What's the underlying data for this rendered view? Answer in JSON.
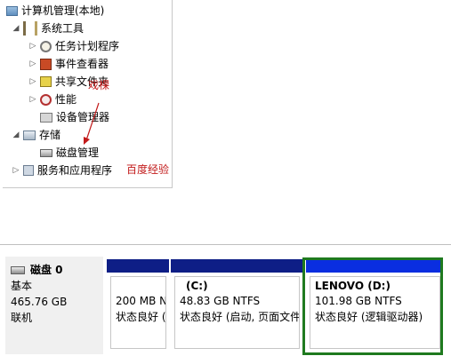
{
  "tree": {
    "root": "计算机管理(本地)",
    "system_tools": "系统工具",
    "task_scheduler": "任务计划程序",
    "event_viewer": "事件查看器",
    "shared_folders": "共享文件夹",
    "performance": "性能",
    "device_manager": "设备管理器",
    "storage": "存储",
    "disk_management": "磁盘管理",
    "services_apps": "服务和应用程序"
  },
  "annotations": {
    "watermark": "百度经验",
    "scribble": "戏棵"
  },
  "disk": {
    "name": "磁盘 0",
    "type": "基本",
    "size": "465.76 GB",
    "status": "联机"
  },
  "partitions": [
    {
      "label": "",
      "size_fs": "200 MB N",
      "status": "状态良好 ("
    },
    {
      "label": "(C:)",
      "size_fs": "48.83 GB NTFS",
      "status": "状态良好 (启动, 页面文件"
    },
    {
      "label": "LENOVO  (D:)",
      "size_fs": "101.98 GB NTFS",
      "status": "状态良好 (逻辑驱动器)"
    }
  ],
  "colors": {
    "primary_partition_bar": "#0e1e86",
    "logical_drive_bar": "#0a2ee0",
    "selection_border": "#1f7a1f",
    "annotation_red": "#c21a1a"
  }
}
